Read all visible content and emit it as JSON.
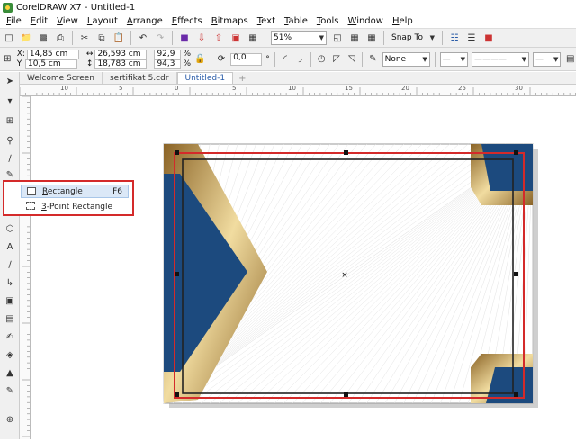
{
  "window": {
    "title": "CorelDRAW X7 - Untitled-1"
  },
  "menu": [
    "File",
    "Edit",
    "View",
    "Layout",
    "Arrange",
    "Effects",
    "Bitmaps",
    "Text",
    "Table",
    "Tools",
    "Window",
    "Help"
  ],
  "toolbar": {
    "zoom": "51%",
    "snap_to": "Snap To"
  },
  "propbar": {
    "x_label": "X:",
    "x_value": "14,85 cm",
    "y_label": "Y:",
    "y_value": "10,5 cm",
    "width_value": "26,593 cm",
    "height_value": "18,783 cm",
    "scale_x": "92,9",
    "scale_y": "94,3",
    "percent": "%",
    "rotation": "0,0",
    "degree": "°",
    "outline": "None"
  },
  "tabs": [
    "Welcome Screen",
    "sertifikat 5.cdr",
    "Untitled-1"
  ],
  "ruler": {
    "top_ticks": [
      "10",
      "5",
      "0",
      "5",
      "10",
      "15",
      "20",
      "25",
      "30"
    ]
  },
  "flyout": {
    "items": [
      {
        "label": "Rectangle",
        "shortcut": "F6"
      },
      {
        "label": "3-Point Rectangle",
        "shortcut": ""
      }
    ]
  },
  "colors": {
    "navy": "#1c4a7e",
    "gold": "#c8a25a",
    "selection_red": "#d42a2a"
  }
}
